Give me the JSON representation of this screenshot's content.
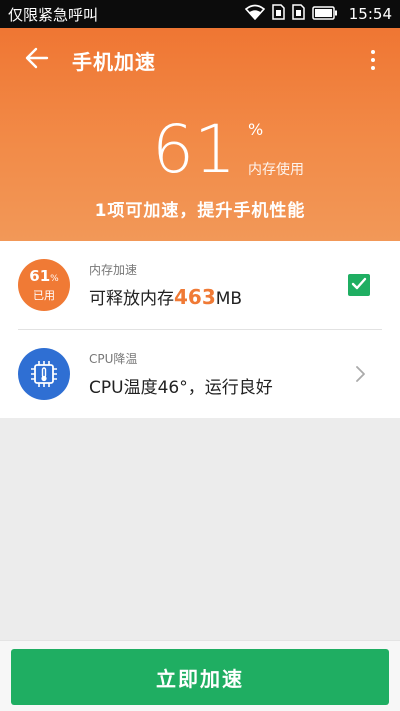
{
  "status_bar": {
    "carrier": "仅限紧急呼叫",
    "time": "15:54",
    "icons": [
      "wifi-icon",
      "sim1-icon",
      "sim2-icon",
      "battery-icon"
    ]
  },
  "header": {
    "title": "手机加速",
    "back_icon": "arrow-left-icon",
    "menu_icon": "more-vertical-icon"
  },
  "summary": {
    "memory_percent": "61",
    "percent_sign": "%",
    "memory_label": "内存使用",
    "subtitle": "1项可加速，提升手机性能"
  },
  "items": [
    {
      "badge_value": "61",
      "badge_unit": "%",
      "badge_label": "已用",
      "label": "内存加速",
      "main_prefix": "可释放内存",
      "main_highlight": "463",
      "main_suffix": "MB",
      "checked": true
    },
    {
      "icon": "cpu-thermometer-icon",
      "label": "CPU降温",
      "main_text": "CPU温度46°，运行良好",
      "action_icon": "chevron-right-icon"
    }
  ],
  "primary_button": "立即加速",
  "colors": {
    "accent_orange": "#f07a35",
    "accent_green": "#1fae62",
    "cpu_blue": "#2f6fd3"
  }
}
